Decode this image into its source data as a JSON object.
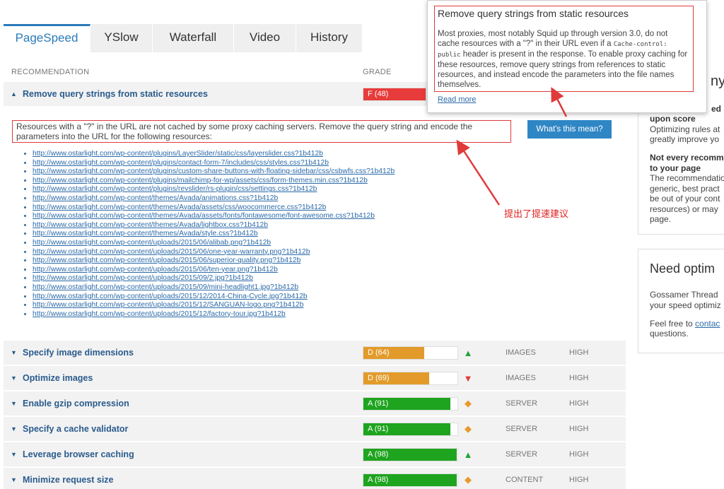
{
  "tabs": [
    {
      "label": "PageSpeed",
      "active": true
    },
    {
      "label": "YSlow",
      "active": false
    },
    {
      "label": "Waterfall",
      "active": false
    },
    {
      "label": "Video",
      "active": false
    },
    {
      "label": "History",
      "active": false
    }
  ],
  "table": {
    "col_recommendation": "RECOMMENDATION",
    "col_grade": "GRADE"
  },
  "expanded": {
    "title": "Remove query strings from static resources",
    "grade_label": "F (48)",
    "grade_score": 48,
    "grade_color": "#e83b3b",
    "description": "Resources with a \"?\" in the URL are not cached by some proxy caching servers. Remove the query string and encode the parameters into the URL for the following resources:",
    "whats_this_button": "What's this mean?",
    "urls": [
      "http://www.ostarlight.com/wp-content/plugins/LayerSlider/static/css/layerslider.css?1b412b",
      "http://www.ostarlight.com/wp-content/plugins/contact-form-7/includes/css/styles.css?1b412b",
      "http://www.ostarlight.com/wp-content/plugins/custom-share-buttons-with-floating-sidebar/css/csbwfs.css?1b412b",
      "http://www.ostarlight.com/wp-content/plugins/mailchimp-for-wp/assets/css/form-themes.min.css?1b412b",
      "http://www.ostarlight.com/wp-content/plugins/revslider/rs-plugin/css/settings.css?1b412b",
      "http://www.ostarlight.com/wp-content/themes/Avada/animations.css?1b412b",
      "http://www.ostarlight.com/wp-content/themes/Avada/assets/css/woocommerce.css?1b412b",
      "http://www.ostarlight.com/wp-content/themes/Avada/assets/fonts/fontawesome/font-awesome.css?1b412b",
      "http://www.ostarlight.com/wp-content/themes/Avada/lightbox.css?1b412b",
      "http://www.ostarlight.com/wp-content/themes/Avada/style.css?1b412b",
      "http://www.ostarlight.com/wp-content/uploads/2015/06/alibab.png?1b412b",
      "http://www.ostarlight.com/wp-content/uploads/2015/06/one-year-warranty.png?1b412b",
      "http://www.ostarlight.com/wp-content/uploads/2015/06/superior-quality.png?1b412b",
      "http://www.ostarlight.com/wp-content/uploads/2015/06/ten-year.png?1b412b",
      "http://www.ostarlight.com/wp-content/uploads/2015/09/2.jpg?1b412b",
      "http://www.ostarlight.com/wp-content/uploads/2015/09/mini-headlight1.jpg?1b412b",
      "http://www.ostarlight.com/wp-content/uploads/2015/12/2014-China-Cycle.jpg?1b412b",
      "http://www.ostarlight.com/wp-content/uploads/2015/12/SANGUAN-logo.png?1b412b",
      "http://www.ostarlight.com/wp-content/uploads/2015/12/factory-tour.jpg?1b412b"
    ]
  },
  "annotation_note": "提出了提速建议",
  "popup": {
    "title": "Remove query strings from static resources",
    "text_before_code": "Most proxies, most notably Squid up through version 3.0, do not cache resources with a \"?\" in their URL even if a ",
    "code": "Cache-control: public",
    "text_after_code": " header is present in the response. To enable proxy caching for these resources, remove query strings from references to static resources, and instead encode the parameters into the file names themselves.",
    "read_more": "Read more"
  },
  "rows": [
    {
      "title": "Specify image dimensions",
      "grade_label": "D (64)",
      "grade_score": 64,
      "grade_color": "#e29b2a",
      "trend": "up",
      "type": "IMAGES",
      "priority": "HIGH"
    },
    {
      "title": "Optimize images",
      "grade_label": "D (69)",
      "grade_score": 69,
      "grade_color": "#e29b2a",
      "trend": "down",
      "type": "IMAGES",
      "priority": "HIGH"
    },
    {
      "title": "Enable gzip compression",
      "grade_label": "A (91)",
      "grade_score": 91,
      "grade_color": "#1ea41e",
      "trend": "same",
      "type": "SERVER",
      "priority": "HIGH"
    },
    {
      "title": "Specify a cache validator",
      "grade_label": "A (91)",
      "grade_score": 91,
      "grade_color": "#1ea41e",
      "trend": "same",
      "type": "SERVER",
      "priority": "HIGH"
    },
    {
      "title": "Leverage browser caching",
      "grade_label": "A (98)",
      "grade_score": 98,
      "grade_color": "#1ea41e",
      "trend": "up",
      "type": "SERVER",
      "priority": "HIGH"
    },
    {
      "title": "Minimize request size",
      "grade_label": "A (98)",
      "grade_score": 98,
      "grade_color": "#1ea41e",
      "trend": "same",
      "type": "CONTENT",
      "priority": "HIGH"
    }
  ],
  "side_panel_1": {
    "heading_partial": "ny",
    "bold_partial": "ed",
    "line1": "upon score",
    "line2": "Optimizing rules at",
    "line3": "greatly improve yo",
    "bold2a": "Not every recomm",
    "bold2b": "to your page",
    "line4": "The recommendatio",
    "line5": "generic, best pract",
    "line6": "be out of your cont",
    "line7": "resources) or may",
    "line8": "page."
  },
  "side_panel_2": {
    "heading": "Need optim",
    "line1": "Gossamer Thread",
    "line2": "your speed optimiz",
    "line3a": "Feel free to ",
    "line3_link": "contac",
    "line4": "questions."
  },
  "colors": {
    "accent": "#2b7bb9",
    "annotation_red": "#e03a3a"
  }
}
